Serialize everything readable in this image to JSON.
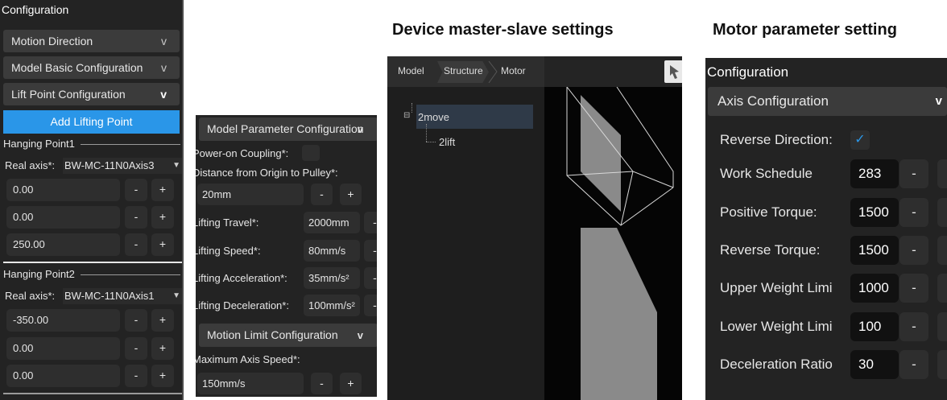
{
  "headings": {
    "master_slave": "Device master-slave settings",
    "motor": "Motor parameter setting"
  },
  "panel1": {
    "title": "Configuration",
    "sections": [
      "Motion Direction",
      "Model Basic Configuration",
      "Lift Point Configuration"
    ],
    "chevrons": [
      "v",
      "v",
      "v"
    ],
    "add_button": "Add Lifting Point",
    "hanging_points": [
      {
        "name": "Hanging Point1",
        "real_axis_label": "Real axis*:",
        "axis": "BW-MC-11N0Axis3",
        "values": [
          "0.00",
          "0.00",
          "250.00"
        ]
      },
      {
        "name": "Hanging Point2",
        "real_axis_label": "Real axis*:",
        "axis": "BW-MC-11N0Axis1",
        "values": [
          "-350.00",
          "0.00",
          "0.00"
        ]
      }
    ],
    "minus": "-",
    "plus": "+"
  },
  "panel2": {
    "section1": "Model Parameter Configuration",
    "power_on": "Power-on Coupling*:",
    "distance_label": "Distance from Origin to Pulley*:",
    "distance_value": "20mm",
    "rows": [
      {
        "label": "Lifting Travel*:",
        "value": "2000mm"
      },
      {
        "label": "Lifting Speed*:",
        "value": "80mm/s"
      },
      {
        "label": "Lifting Acceleration*:",
        "value": "35mm/s²"
      },
      {
        "label": "Lifting Deceleration*:",
        "value": "100mm/s²"
      }
    ],
    "section2": "Motion Limit Configuration",
    "max_speed_label": "Maximum Axis Speed*:",
    "max_speed_value": "150mm/s",
    "chevron": "v",
    "minus": "-",
    "plus": "+"
  },
  "panel3": {
    "tabs": [
      "Model",
      "Structure",
      "Motor"
    ],
    "tree": {
      "collapse": "⊟",
      "parent": "2move",
      "child": "2lift"
    }
  },
  "panel4": {
    "title": "Configuration",
    "section": "Axis Configuration",
    "chevron": "v",
    "reverse_label": "Reverse Direction:",
    "check": "✓",
    "rows": [
      {
        "label": "Work Schedule",
        "value": "283"
      },
      {
        "label": "Positive Torque:",
        "value": "1500"
      },
      {
        "label": "Reverse Torque:",
        "value": "1500"
      },
      {
        "label": "Upper Weight Limi",
        "value": "1000"
      },
      {
        "label": "Lower Weight Limi",
        "value": "100"
      },
      {
        "label": "Deceleration Ratio",
        "value": "30"
      }
    ],
    "minus": "-"
  },
  "colors": {
    "accent": "#2a96e8",
    "panel_bg": "#232323",
    "section_bg": "#3b3b3b"
  }
}
